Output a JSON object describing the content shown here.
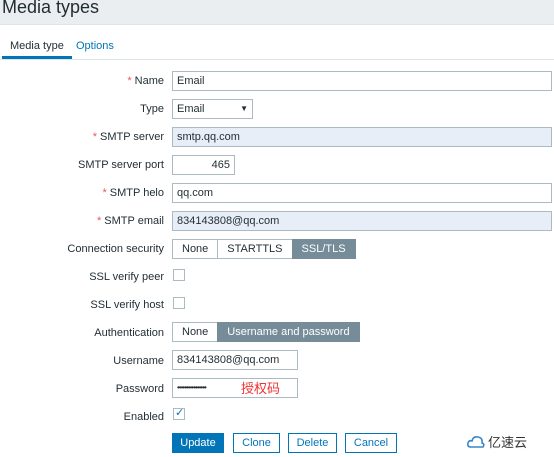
{
  "page": {
    "title": "Media types"
  },
  "tabs": [
    {
      "label": "Media type"
    },
    {
      "label": "Options"
    }
  ],
  "form": {
    "name": {
      "label": "Name",
      "value": "Email"
    },
    "type": {
      "label": "Type",
      "value": "Email"
    },
    "smtp_server": {
      "label": "SMTP server",
      "value": "smtp.qq.com"
    },
    "smtp_port": {
      "label": "SMTP server port",
      "value": "465"
    },
    "smtp_helo": {
      "label": "SMTP helo",
      "value": "qq.com"
    },
    "smtp_email": {
      "label": "SMTP email",
      "value": "834143808@qq.com"
    },
    "connection_security": {
      "label": "Connection security",
      "options": [
        "None",
        "STARTTLS",
        "SSL/TLS"
      ],
      "selected": "SSL/TLS"
    },
    "ssl_verify_peer": {
      "label": "SSL verify peer",
      "checked": false
    },
    "ssl_verify_host": {
      "label": "SSL verify host",
      "checked": false
    },
    "authentication": {
      "label": "Authentication",
      "options": [
        "None",
        "Username and password"
      ],
      "selected": "Username and password"
    },
    "username": {
      "label": "Username",
      "value": "834143808@qq.com"
    },
    "password": {
      "label": "Password",
      "value": "••••••••••••••••",
      "annotation": "授权码"
    },
    "enabled": {
      "label": "Enabled",
      "checked": true
    },
    "required_mark": "*"
  },
  "buttons": {
    "update": "Update",
    "clone": "Clone",
    "delete": "Delete",
    "cancel": "Cancel"
  },
  "watermark": {
    "text": "亿速云"
  },
  "colors": {
    "accent": "#0275b8",
    "segment_active": "#768d99",
    "required": "#e45959",
    "annotation": "#ee3333"
  }
}
